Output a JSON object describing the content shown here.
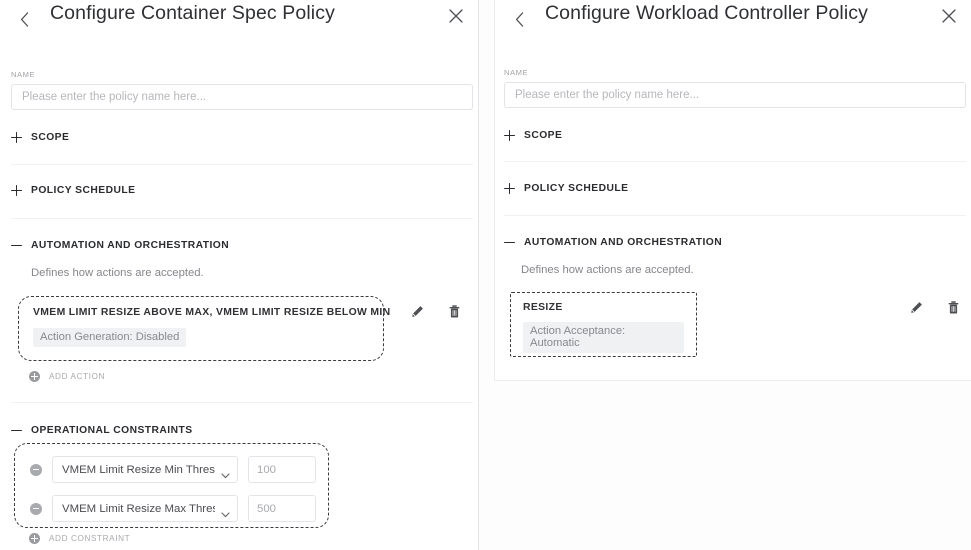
{
  "left_panel": {
    "header": {
      "back_icon": "chevron-left-icon",
      "title": "Configure Container Spec Policy",
      "close_icon": "close-icon"
    },
    "name_field": {
      "label": "NAME",
      "value": "",
      "placeholder": "Please enter the policy name here..."
    },
    "sections": [
      {
        "id": "scope",
        "title": "SCOPE",
        "expanded": false,
        "toggle": "plus"
      },
      {
        "id": "policy-schedule",
        "title": "POLICY SCHEDULE",
        "expanded": false,
        "toggle": "plus"
      },
      {
        "id": "automation-and-orchestration",
        "title": "AUTOMATION AND ORCHESTRATION",
        "expanded": true,
        "toggle": "minus",
        "description": "Defines how actions are accepted.",
        "cards": [
          {
            "title": "VMEM LIMIT RESIZE ABOVE MAX, VMEM LIMIT RESIZE BELOW MIN",
            "chip": "Action Generation: Disabled",
            "edit_icon": "pencil-icon",
            "delete_icon": "trash-icon"
          }
        ],
        "add_link": {
          "label": "ADD ACTION",
          "icon": "plus-circle-icon"
        }
      },
      {
        "id": "operational-constraints",
        "title": "OPERATIONAL CONSTRAINTS",
        "expanded": true,
        "toggle": "minus",
        "constraints": [
          {
            "remove_icon": "minus-circle-icon",
            "select_value": "VMEM Limit Resize Min Thresho",
            "value": "",
            "value_placeholder": "100"
          },
          {
            "remove_icon": "minus-circle-icon",
            "select_value": "VMEM Limit Resize Max Thresho",
            "value": "",
            "value_placeholder": "500"
          }
        ],
        "add_link": {
          "label": "ADD CONSTRAINT",
          "icon": "plus-circle-icon"
        }
      }
    ]
  },
  "right_panel": {
    "header": {
      "back_icon": "chevron-left-icon",
      "title": "Configure Workload Controller Policy",
      "close_icon": "close-icon"
    },
    "name_field": {
      "label": "NAME",
      "value": "",
      "placeholder": "Please enter the policy name here..."
    },
    "sections": [
      {
        "id": "scope",
        "title": "SCOPE",
        "expanded": false,
        "toggle": "plus"
      },
      {
        "id": "policy-schedule",
        "title": "POLICY SCHEDULE",
        "expanded": false,
        "toggle": "plus"
      },
      {
        "id": "automation-and-orchestration",
        "title": "AUTOMATION AND ORCHESTRATION",
        "expanded": true,
        "toggle": "minus",
        "description": "Defines how actions are accepted.",
        "cards": [
          {
            "title": "RESIZE",
            "chip": "Action Acceptance: Automatic",
            "edit_icon": "pencil-icon",
            "delete_icon": "trash-icon"
          }
        ]
      }
    ]
  },
  "colors": {
    "panel_background": "#ffffff",
    "title_text": "#2f3033",
    "section_title": "#2b2c2f",
    "muted_text": "#85868b",
    "placeholder": "#b6b7bb",
    "border": "#e3e4e7",
    "divider": "#f0f1f3",
    "chip_background": "#f0f1f3",
    "dashed_border": "#3a3b3e"
  }
}
